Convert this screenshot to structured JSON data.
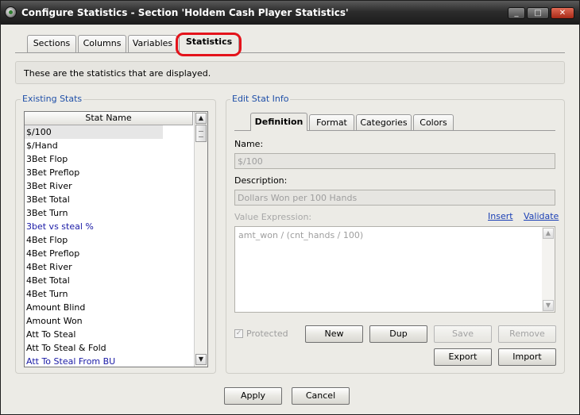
{
  "window": {
    "title": "Configure Statistics - Section 'Holdem Cash Player Statistics'",
    "minimize_glyph": "_",
    "maximize_glyph": "□",
    "close_glyph": "✕"
  },
  "tabs": [
    {
      "label": "Sections"
    },
    {
      "label": "Columns"
    },
    {
      "label": "Variables"
    },
    {
      "label": "Statistics",
      "active": true
    }
  ],
  "info_text": "These are the statistics that are displayed.",
  "existing_stats": {
    "group_label": "Existing Stats",
    "column_header": "Stat Name",
    "items": [
      "$/100",
      "$/Hand",
      "3Bet Flop",
      "3Bet Preflop",
      "3Bet River",
      "3Bet Total",
      "3Bet Turn",
      "3bet vs steal %",
      "4Bet Flop",
      "4Bet Preflop",
      "4Bet River",
      "4Bet Total",
      "4Bet Turn",
      "Amount Blind",
      "Amount Won",
      "Att To Steal",
      "Att To Steal & Fold",
      "Att To Steal From BU"
    ],
    "selected_index": 0,
    "highlighted_indices": [
      7,
      17
    ],
    "scroll_up": "▲",
    "scroll_down": "▼"
  },
  "edit_stat": {
    "group_label": "Edit Stat Info",
    "tabs": [
      {
        "label": "Definition",
        "active": true
      },
      {
        "label": "Format"
      },
      {
        "label": "Categories"
      },
      {
        "label": "Colors"
      }
    ],
    "name_label": "Name:",
    "name_value": "$/100",
    "description_label": "Description:",
    "description_value": "Dollars Won per 100 Hands",
    "value_expression_label": "Value Expression:",
    "insert_link": "Insert",
    "validate_link": "Validate",
    "value_expression": "amt_won / (cnt_hands / 100)",
    "protected_label": "Protected",
    "protected_checked": true,
    "buttons": {
      "new": "New",
      "dup": "Dup",
      "save": "Save",
      "remove": "Remove",
      "export": "Export",
      "import": "Import"
    }
  },
  "footer": {
    "apply": "Apply",
    "cancel": "Cancel"
  },
  "colors": {
    "highlight_ring": "#e4131b",
    "group_label": "#1f4fa8",
    "link": "#1a3fb5",
    "list_item_highlight": "#1a1aa6"
  }
}
